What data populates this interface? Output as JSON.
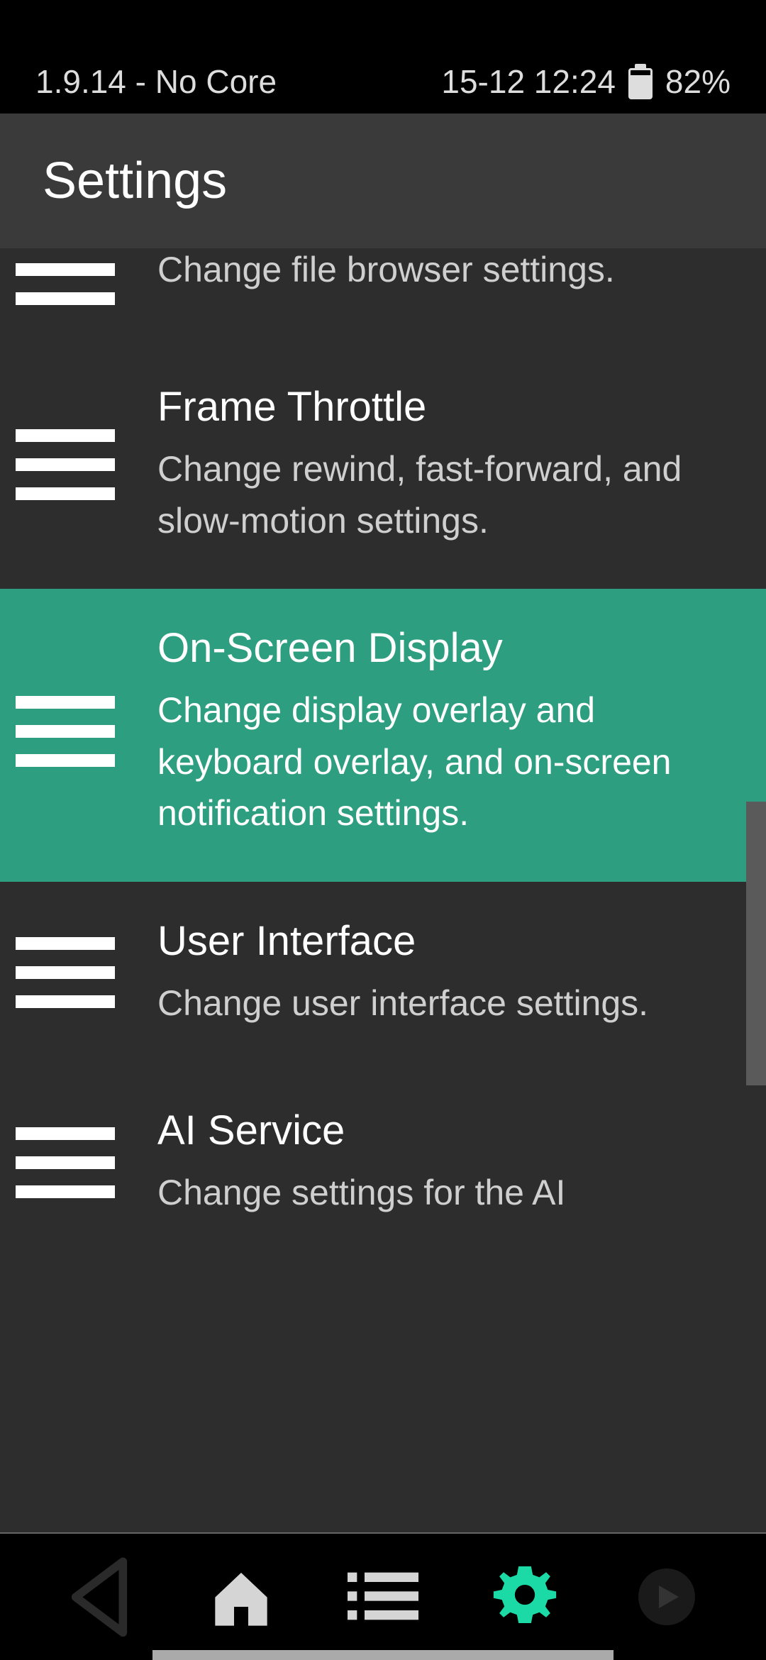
{
  "statusbar": {
    "left": "1.9.14 - No Core",
    "time": "15-12 12:24",
    "battery": "82%"
  },
  "header": {
    "title": "Settings"
  },
  "items": [
    {
      "title": "",
      "subtitle": "Change file browser settings."
    },
    {
      "title": "Frame Throttle",
      "subtitle": "Change rewind, fast-forward, and slow-motion settings."
    },
    {
      "title": "On-Screen Display",
      "subtitle": "Change display overlay and keyboard overlay, and on-screen notification settings."
    },
    {
      "title": "User Interface",
      "subtitle": "Change user interface settings."
    },
    {
      "title": "AI Service",
      "subtitle": "Change settings for the AI"
    }
  ],
  "colors": {
    "accent": "#1cdaa5",
    "selected": "#2d9e7f"
  }
}
